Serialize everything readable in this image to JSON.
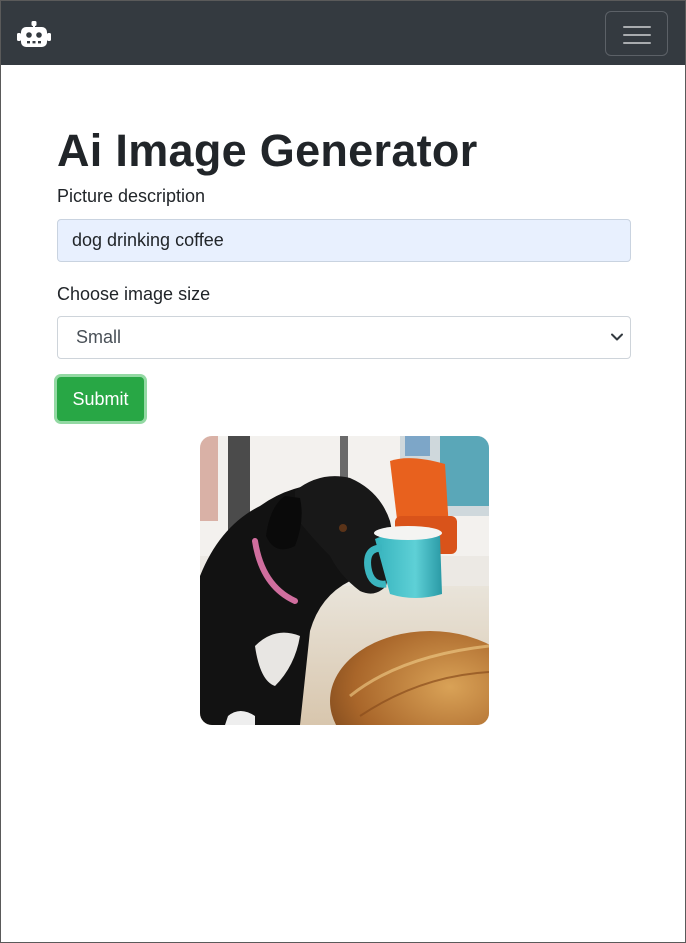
{
  "navbar": {
    "brand_icon": "robot-icon",
    "toggler_icon": "hamburger-menu-icon"
  },
  "main": {
    "title": "Ai Image Generator",
    "description_label": "Picture description",
    "description_value": "dog drinking coffee",
    "size_label": "Choose image size",
    "size_selected": "Small",
    "submit_label": "Submit"
  },
  "result_image": {
    "icon": "generated-image",
    "subject": "dog with coffee mug"
  },
  "colors": {
    "navbar_bg": "#343a40",
    "submit_bg": "#28a745",
    "input_autofill_bg": "#e8f0fe"
  }
}
